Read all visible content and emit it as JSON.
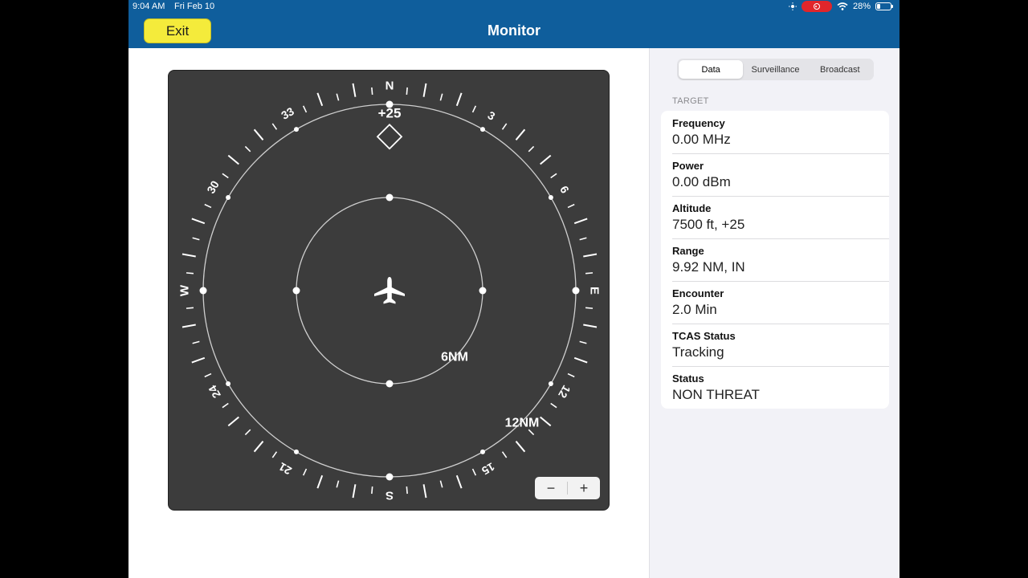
{
  "status_bar": {
    "time": "9:04 AM",
    "date": "Fri Feb 10",
    "battery": "28%",
    "battery_level": 0.28
  },
  "nav": {
    "title": "Monitor",
    "exit_label": "Exit"
  },
  "radar": {
    "cardinals": {
      "n": "N",
      "e": "E",
      "s": "S",
      "w": "W"
    },
    "headings": [
      "3",
      "6",
      "12",
      "15",
      "21",
      "24",
      "30",
      "33"
    ],
    "inner_ring_label": "6NM",
    "outer_ring_label": "12NM",
    "target": {
      "altitude_label": "+25",
      "bearing_deg": 0,
      "range_nm": 9.92
    },
    "zoom": {
      "minus": "−",
      "plus": "+"
    }
  },
  "tabs": [
    {
      "label": "Data",
      "active": true
    },
    {
      "label": "Surveillance",
      "active": false
    },
    {
      "label": "Broadcast",
      "active": false
    }
  ],
  "target_section": {
    "header": "TARGET",
    "rows": [
      {
        "label": "Frequency",
        "value": "0.00 MHz"
      },
      {
        "label": "Power",
        "value": "0.00 dBm"
      },
      {
        "label": "Altitude",
        "value": "7500 ft, +25"
      },
      {
        "label": "Range",
        "value": "9.92 NM, IN"
      },
      {
        "label": "Encounter",
        "value": "2.0 Min"
      },
      {
        "label": "TCAS Status",
        "value": "Tracking"
      },
      {
        "label": "Status",
        "value": "NON THREAT"
      }
    ]
  },
  "colors": {
    "nav_bar": "#0f5e9c",
    "exit_button": "#f4eb3b",
    "radar_bg": "#3c3c3c",
    "recording": "#e0262b"
  }
}
